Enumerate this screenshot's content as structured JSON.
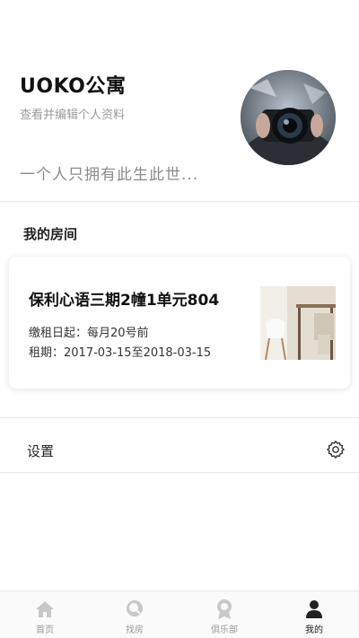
{
  "profile": {
    "app_name": "UOKO公寓",
    "edit_link": "查看并编辑个人资料",
    "motto": "一个人只拥有此生此世..."
  },
  "my_room": {
    "section_title": "我的房间",
    "room_name": "保利心语三期2幢1单元804",
    "rent_day_label": "缴租日起：",
    "rent_day_value": "每月20号前",
    "term_label": "租期：",
    "term_value": "2017-03-15至2018-03-15"
  },
  "settings": {
    "label": "设置",
    "icon": "gear-icon"
  },
  "tabbar": {
    "tabs": [
      {
        "label": "首页",
        "icon": "home-icon",
        "active": false
      },
      {
        "label": "找房",
        "icon": "search-house-icon",
        "active": false
      },
      {
        "label": "俱乐部",
        "icon": "club-badge-icon",
        "active": false
      },
      {
        "label": "我的",
        "icon": "person-icon",
        "active": true
      }
    ]
  },
  "colors": {
    "text_primary": "#111111",
    "text_secondary": "#9a9a9a",
    "tab_inactive": "#bdbdbd",
    "tab_active": "#222222"
  }
}
